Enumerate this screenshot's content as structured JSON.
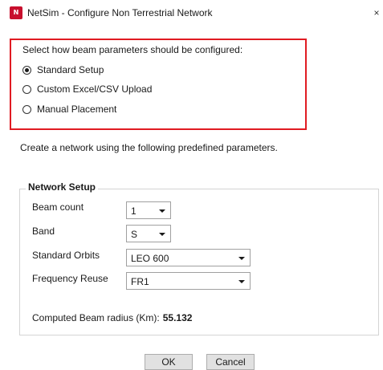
{
  "window": {
    "title": "NetSim - Configure Non Terrestrial Network",
    "close_glyph": "×",
    "icon_glyph": "N"
  },
  "beam_config": {
    "prompt": "Select how beam parameters should be configured:",
    "options": [
      {
        "label": "Standard Setup",
        "selected": true
      },
      {
        "label": "Custom Excel/CSV Upload",
        "selected": false
      },
      {
        "label": "Manual Placement",
        "selected": false
      }
    ]
  },
  "description": "Create a network using the following predefined parameters.",
  "network_setup": {
    "legend": "Network Setup",
    "beam_count": {
      "label": "Beam count",
      "value": "1"
    },
    "band": {
      "label": "Band",
      "value": "S"
    },
    "standard_orbits": {
      "label": "Standard Orbits",
      "value": "LEO 600"
    },
    "frequency_reuse": {
      "label": "Frequency Reuse",
      "value": "FR1"
    },
    "computed_radius": {
      "label": "Computed Beam radius (Km):",
      "value": "55.132"
    }
  },
  "buttons": {
    "ok": "OK",
    "cancel": "Cancel"
  },
  "colors": {
    "highlight": "#e01b22",
    "app_icon": "#c8102e"
  }
}
